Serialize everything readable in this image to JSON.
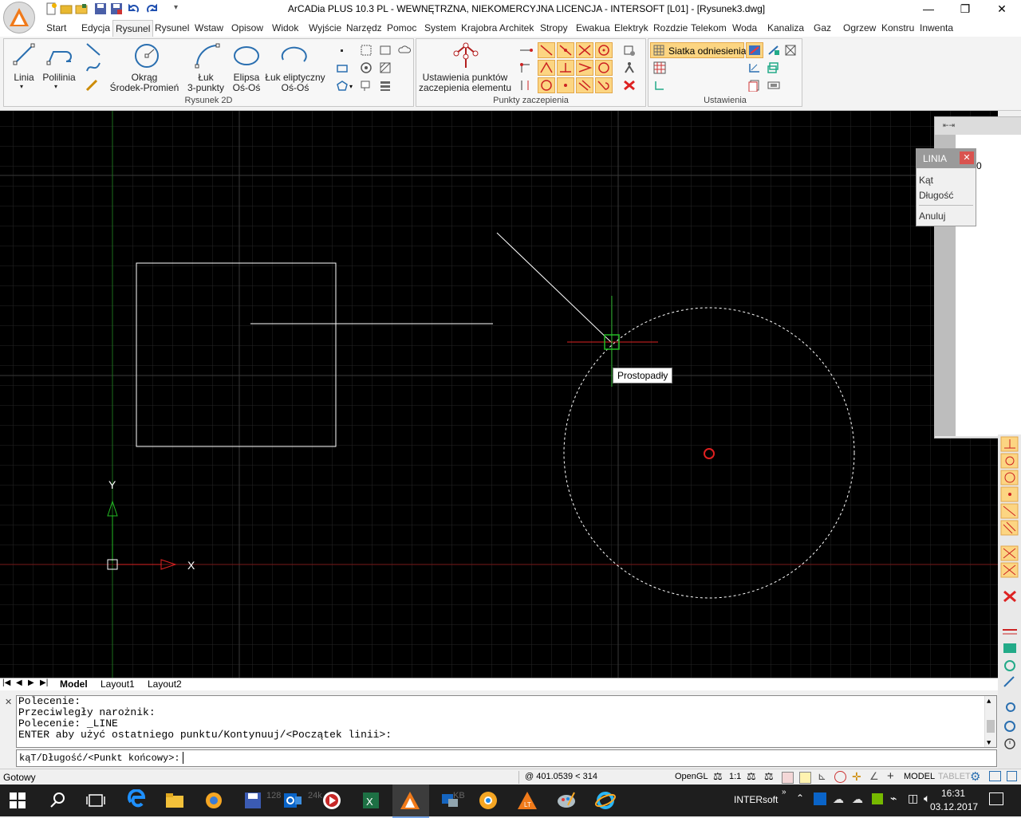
{
  "app": {
    "title": "ArCADia PLUS 10.3 PL - WEWNĘTRZNA, NIEKOMERCYJNA LICENCJA - INTERSOFT [L01] - [Rysunek3.dwg]",
    "window_buttons": {
      "minimize": "—",
      "restore": "❐",
      "close": "✕"
    }
  },
  "tabs": [
    "Start",
    "Edycja",
    "Rysunel",
    "Rysunel",
    "Wstaw",
    "Opisow",
    "Widok",
    "Wyjście",
    "Narzędz",
    "Pomoc",
    "System",
    "Krajobra",
    "Architek",
    "Stropy",
    "Ewakua",
    "Elektryk",
    "Rozdzie",
    "Telekom",
    "Woda",
    "Kanaliza",
    "Gaz",
    "Ogrzew",
    "Konstru",
    "Inwenta"
  ],
  "active_tab_index": 2,
  "ribbon": {
    "panel_rysunek": {
      "title": "Rysunek 2D",
      "linia": "Linia",
      "polilinia": "Polilinia",
      "okrag_1": "Okrąg",
      "okrag_2": "Środek-Promień",
      "luk_1": "Łuk",
      "luk_2": "3-punkty",
      "elipsa_1": "Elipsa",
      "elipsa_2": "Oś-Oś",
      "luk_elip_1": "Łuk eliptyczny",
      "luk_elip_2": "Oś-Oś"
    },
    "panel_punkty": {
      "title": "Punkty zaczepienia",
      "settings_1": "Ustawienia punktów",
      "settings_2": "zaczepienia elementu"
    },
    "panel_ustawienia": {
      "title": "Ustawienia",
      "siatka": "Siatka odniesienia"
    }
  },
  "canvas": {
    "snap_tooltip": "Prostopadły",
    "axis_x": "X",
    "axis_y": "Y",
    "colors": {
      "background": "#000000",
      "grid": "#2e2e2e",
      "entity": "#ffffff",
      "snap": "#22bb22",
      "crosshair_x": "#dd2222",
      "crosshair_y": "#22aa22",
      "center_marker": "#dd2222"
    }
  },
  "popup": {
    "title": "LINIA",
    "items": [
      "Kąt",
      "Długość",
      "Anuluj"
    ],
    "behind_value": "0"
  },
  "layout_tabs": [
    "Model",
    "Layout1",
    "Layout2"
  ],
  "command": {
    "history": [
      "Polecenie:",
      "Przeciwległy narożnik:",
      "Polecenie: _LINE",
      "ENTER aby użyć ostatniego punktu/Kontynuuj/<Początek linii>:"
    ],
    "prompt": "kąT/Długość/<Punkt końcowy>: "
  },
  "status": {
    "left": "Gotowy",
    "coords": "@ 401.0539 < 314",
    "opengl": "OpenGL",
    "scale": "1:1",
    "model": "MODEL",
    "tablet": "TABLET"
  },
  "taskbar": {
    "file_size_1": "128",
    "file_size_2": "24k",
    "file_size_3": "KB",
    "tray_label": "INTERsoft",
    "time": "16:31",
    "date": "03.12.2017"
  }
}
